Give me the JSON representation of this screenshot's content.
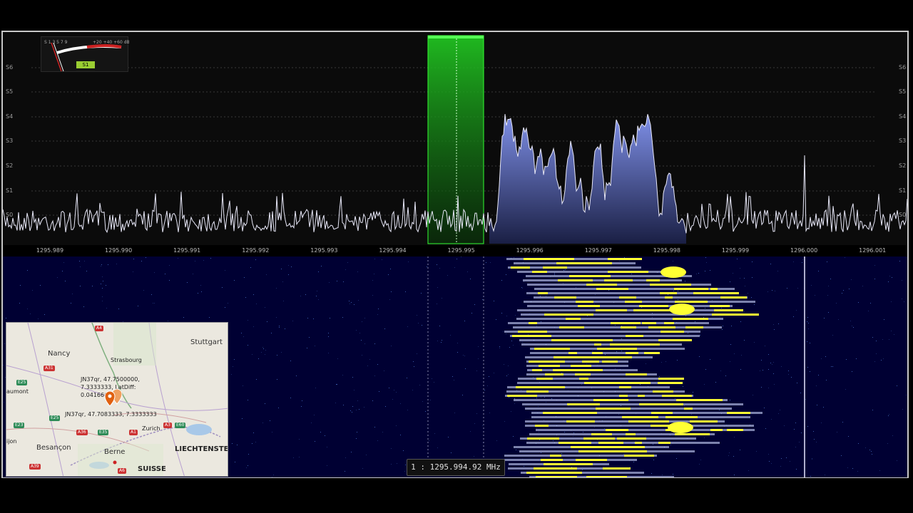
{
  "spectrum": {
    "s_levels": [
      "S6",
      "S5",
      "S4",
      "S3",
      "S2",
      "S1",
      "S0"
    ],
    "freq_ticks": [
      "1295.989",
      "1295.990",
      "1295.991",
      "1295.992",
      "1295.993",
      "1295.994",
      "1295.995",
      "1295.996",
      "1295.997",
      "1295.998",
      "1295.999",
      "1296.000",
      "1296.001"
    ],
    "trace_color": "#e8e8f8",
    "fill_color": "#5a6cc0",
    "filter_color": "#22cc22"
  },
  "smeter": {
    "scale_left": [
      "S",
      "1",
      "3",
      "5",
      "7",
      "9"
    ],
    "scale_right": [
      "+20",
      "+40",
      "+60",
      "dB"
    ],
    "value_badge": "S1"
  },
  "readout": {
    "text": "1 : 1295.994.92 MHz"
  },
  "map": {
    "cities": {
      "stuttgart": "Stuttgart",
      "nancy": "Nancy",
      "strasbourg": "Strasbourg",
      "chaumont": "aumont",
      "besancon": "Besançon",
      "dijon": "ijon",
      "zurich": "Zurich",
      "berne": "Berne",
      "liechtenstein": "LIECHTENSTEIN",
      "suisse": "SUISSE"
    },
    "marker_label_1": "JN37qr, 47.7500000, 7.3333333, LatDiff: 0.0416667",
    "marker_label_2": "JN37qr, 47.7083333, 7.3333333",
    "road_badges": [
      "A4",
      "A31",
      "E25",
      "A36",
      "E35",
      "A3",
      "E60",
      "A39",
      "A6",
      "A1",
      "E23",
      "E25"
    ],
    "marker_color": "#e06010"
  },
  "colors": {
    "waterfall_bg": "#000033",
    "waterfall_signal": "#ffff33"
  }
}
